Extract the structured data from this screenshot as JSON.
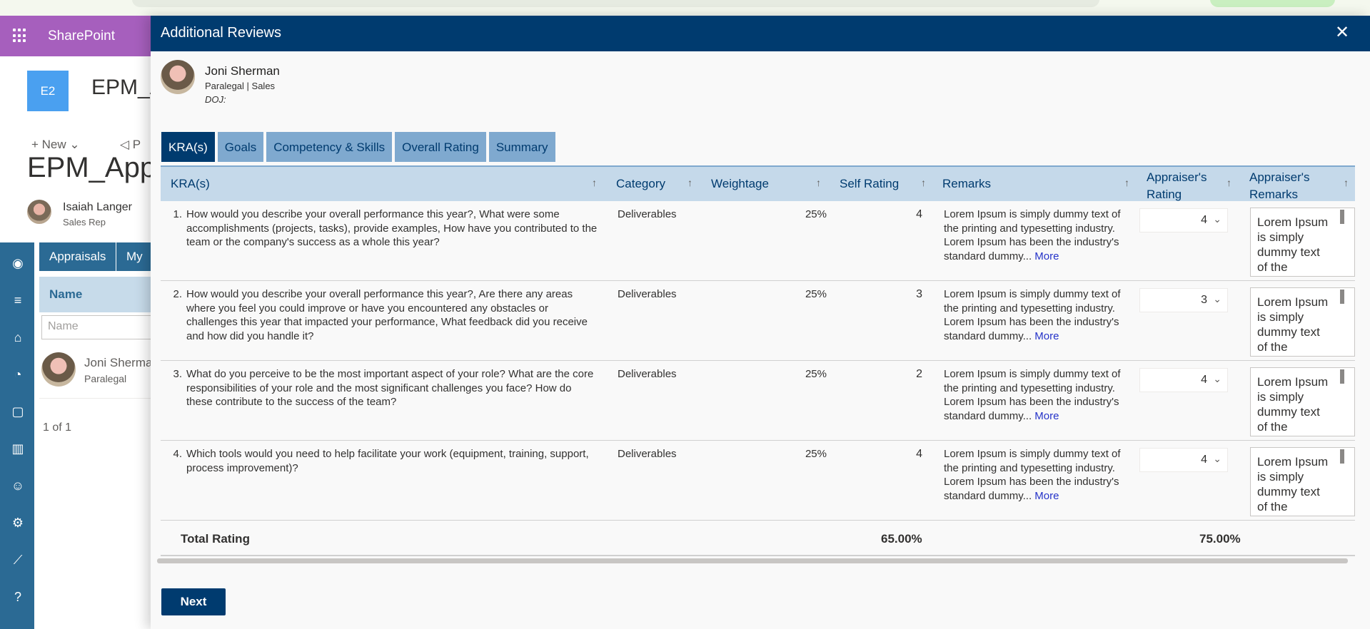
{
  "suite": {
    "brand": "SharePoint"
  },
  "site": {
    "logo_text": "E2",
    "title": "EPM_A",
    "cmd_new": "New",
    "cmd_promote": "P",
    "page_title": "EPM_App",
    "person": {
      "name": "Isaiah Langer",
      "role": "Sales Rep"
    },
    "tabs": [
      "Appraisals",
      "My T"
    ],
    "list_header": "Name",
    "filter_placeholder": "Name",
    "row": {
      "name": "Joni Sherma",
      "role": "Paralegal"
    },
    "pager": "1 of 1"
  },
  "panel": {
    "title": "Additional Reviews",
    "employee": {
      "name": "Joni Sherman",
      "role": "Paralegal | Sales",
      "doj": "DOJ:"
    },
    "tabs": [
      "KRA(s)",
      "Goals",
      "Competency & Skills",
      "Overall Rating",
      "Summary"
    ],
    "active_tab": "KRA(s)",
    "columns": {
      "kra": "KRA(s)",
      "category": "Category",
      "weightage": "Weightage",
      "self_rating": "Self Rating",
      "remarks": "Remarks",
      "appraiser_rating_1": "Appraiser's",
      "appraiser_rating_2": "Rating",
      "appraiser_remarks_1": "Appraiser's",
      "appraiser_remarks_2": "Remarks"
    },
    "rows": [
      {
        "num": "1.",
        "question": "How would you describe your overall performance this year?, What were some accomplishments (projects, tasks), provide examples, How have you contributed to the team or the company's success as a whole this year?",
        "category": "Deliverables",
        "weightage": "25%",
        "self_rating": "4",
        "remarks": "Lorem Ipsum is simply dummy text of the printing and typesetting industry. Lorem Ipsum has been the industry's standard dummy...",
        "more": "More",
        "appraiser_rating": "4",
        "appraiser_remarks": "Lorem Ipsum is simply dummy text of the"
      },
      {
        "num": "2.",
        "question": "How would you describe your overall performance this year?, Are there any areas where you feel you could improve or have you encountered any obstacles or challenges this year that impacted your performance, What feedback did you receive and how did you handle it?",
        "category": "Deliverables",
        "weightage": "25%",
        "self_rating": "3",
        "remarks": "Lorem Ipsum is simply dummy text of the printing and typesetting industry. Lorem Ipsum has been the industry's standard dummy...",
        "more": "More",
        "appraiser_rating": "3",
        "appraiser_remarks": "Lorem Ipsum is simply dummy text of the"
      },
      {
        "num": "3.",
        "question": "What do you perceive to be the most important aspect of your role? What are the core responsibilities of your role and the most significant challenges you face? How do these contribute to the success of the team?",
        "category": "Deliverables",
        "weightage": "25%",
        "self_rating": "2",
        "remarks": "Lorem Ipsum is simply dummy text of the printing and typesetting industry. Lorem Ipsum has been the industry's standard dummy...",
        "more": "More",
        "appraiser_rating": "4",
        "appraiser_remarks": "Lorem Ipsum is simply dummy text of the"
      },
      {
        "num": "4.",
        "question": "Which tools would you need to help facilitate your work (equipment, training, support, process improvement)?",
        "category": "Deliverables",
        "weightage": "25%",
        "self_rating": "4",
        "remarks": "Lorem Ipsum is simply dummy text of the printing and typesetting industry. Lorem Ipsum has been the industry's standard dummy...",
        "more": "More",
        "appraiser_rating": "4",
        "appraiser_remarks": "Lorem Ipsum is simply dummy text of the"
      }
    ],
    "total": {
      "label": "Total Rating",
      "self": "65.00%",
      "appraiser": "75.00%"
    },
    "next_label": "Next"
  },
  "colors": {
    "header": "#003b6f",
    "suite": "#a65fbd",
    "rail": "#2b6a94",
    "link": "#2533c9"
  }
}
